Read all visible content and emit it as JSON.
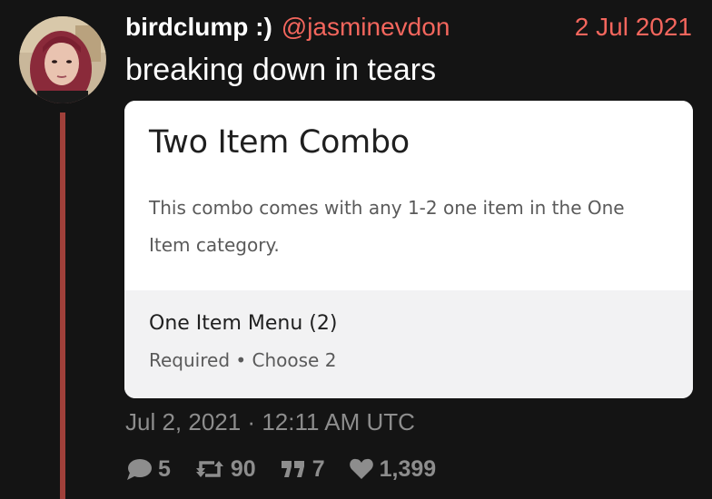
{
  "tweet": {
    "display_name": "birdclump :)",
    "handle": "@jasminevdon",
    "date": "2 Jul 2021",
    "text": "breaking down in tears",
    "timestamp": "Jul 2, 2021 · 12:11 AM UTC"
  },
  "card": {
    "title": "Two Item Combo",
    "description": "This combo comes with any 1-2 one item in the One Item category.",
    "section_title": "One Item Menu (2)",
    "section_subtitle": "Required • Choose 2"
  },
  "stats": {
    "replies": "5",
    "retweets": "90",
    "quotes": "7",
    "likes": "1,399"
  },
  "colors": {
    "background": "#141414",
    "accent": "#f3665d",
    "thread_line": "#a0403a",
    "muted": "#8d8d8d"
  },
  "icons": {
    "replies": "reply-bubble-icon",
    "retweets": "retweet-icon",
    "quotes": "quote-icon",
    "likes": "heart-icon"
  }
}
